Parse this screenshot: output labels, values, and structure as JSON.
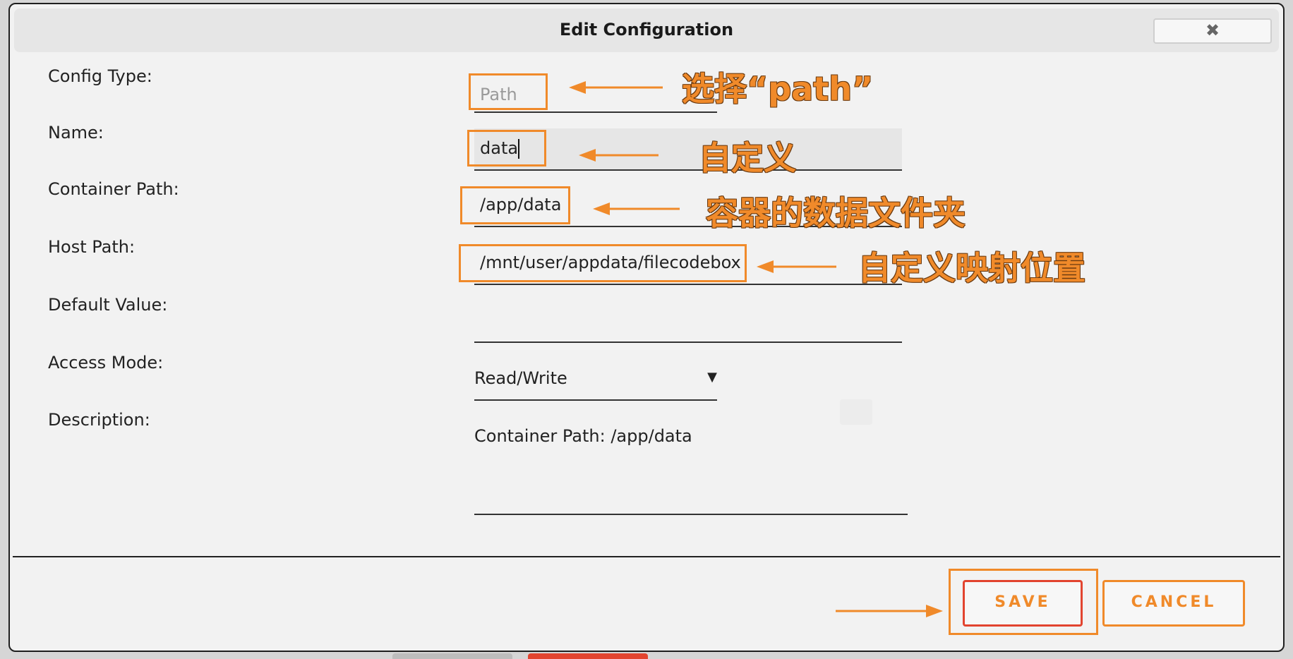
{
  "dialog": {
    "title": "Edit Configuration",
    "close_icon": "close-icon"
  },
  "form": {
    "config_type": {
      "label": "Config Type:",
      "value": "Path"
    },
    "name": {
      "label": "Name:",
      "value": "data"
    },
    "container_path": {
      "label": "Container Path:",
      "value": "/app/data"
    },
    "host_path": {
      "label": "Host Path:",
      "value": "/mnt/user/appdata/filecodebox"
    },
    "default_value": {
      "label": "Default Value:",
      "value": ""
    },
    "access_mode": {
      "label": "Access Mode:",
      "value": "Read/Write",
      "caret": "▼"
    },
    "description": {
      "label": "Description:",
      "value": "Container Path: /app/data"
    }
  },
  "annotations": {
    "config_type_note": "选择“path”",
    "name_note": "自定义",
    "container_path_note": "容器的数据文件夹",
    "host_path_note": "自定义映射位置",
    "highlight_color": "#f08a2a"
  },
  "buttons": {
    "save": "SAVE",
    "cancel": "CANCEL"
  }
}
